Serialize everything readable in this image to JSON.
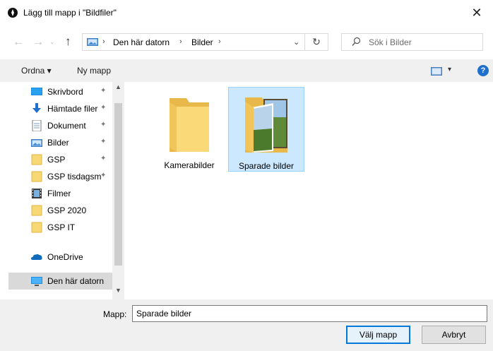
{
  "window": {
    "title": "Lägg till mapp i \"Bildfiler\"",
    "close_glyph": "✕"
  },
  "nav": {
    "back": "←",
    "forward": "→",
    "up": "↑",
    "recent": "⌄",
    "breadcrumbs": [
      "Den här datorn",
      "Bilder"
    ],
    "separator": "›",
    "dropdown": "⌄",
    "refresh": "↻",
    "search_placeholder": "Sök i Bilder"
  },
  "commands": {
    "organize": "Ordna ▾",
    "new_folder": "Ny mapp",
    "view_arrow": "▾",
    "help": "?"
  },
  "sidebar": {
    "items": [
      {
        "label": "Skrivbord",
        "icon": "desktop-icon",
        "pinned": true
      },
      {
        "label": "Hämtade filer",
        "icon": "download-icon",
        "pinned": true
      },
      {
        "label": "Dokument",
        "icon": "document-icon",
        "pinned": true
      },
      {
        "label": "Bilder",
        "icon": "pictures-icon",
        "pinned": true
      },
      {
        "label": "GSP",
        "icon": "folder-icon",
        "pinned": true
      },
      {
        "label": "GSP tisdagsm",
        "icon": "folder-icon",
        "pinned": true
      },
      {
        "label": "Filmer",
        "icon": "film-icon",
        "pinned": false
      },
      {
        "label": "GSP 2020",
        "icon": "folder-icon",
        "pinned": false
      },
      {
        "label": "GSP IT",
        "icon": "folder-icon",
        "pinned": false
      },
      {
        "label": "OneDrive",
        "icon": "onedrive-icon",
        "pinned": false
      },
      {
        "label": "Den här datorn",
        "icon": "this-pc-icon",
        "pinned": false,
        "selected": true
      }
    ],
    "pin_glyph": "📌",
    "scroll_up": "▲",
    "scroll_down": "▼"
  },
  "folders": [
    {
      "name": "Kamerabilder",
      "selected": false
    },
    {
      "name": "Sparade bilder",
      "selected": true
    }
  ],
  "footer": {
    "folder_label": "Mapp:",
    "folder_value": "Sparade bilder",
    "ok": "Välj mapp",
    "cancel": "Avbryt"
  },
  "colors": {
    "accent": "#0078d7",
    "selection": "#cce8ff",
    "folder": "#f8d775"
  }
}
